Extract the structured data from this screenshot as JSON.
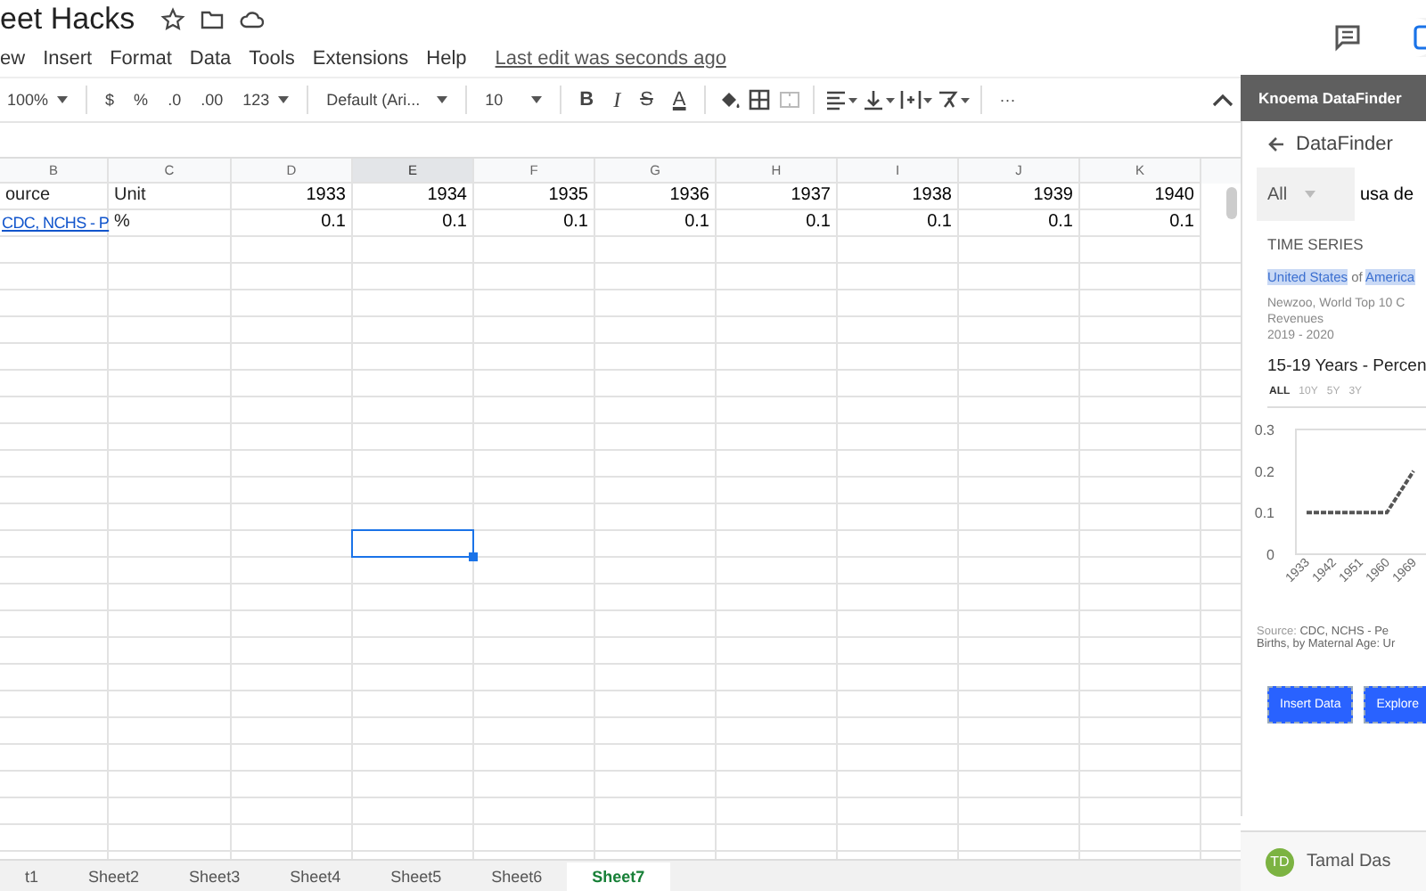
{
  "document": {
    "title": "eet Hacks"
  },
  "menu": [
    "ew",
    "Insert",
    "Format",
    "Data",
    "Tools",
    "Extensions",
    "Help"
  ],
  "last_edit": "Last edit was seconds ago",
  "toolbar": {
    "zoom": "100%",
    "currency": "$",
    "percent": "%",
    "decrease_decimals": ".0",
    "increase_decimals": ".00",
    "number_format": "123",
    "font": "Default (Ari...",
    "font_size": "10",
    "bold": "B",
    "italic": "I",
    "strikethrough": "S",
    "text_color": "A",
    "more": "···"
  },
  "columns": [
    {
      "label": "B",
      "selected": false
    },
    {
      "label": "C",
      "selected": false
    },
    {
      "label": "D",
      "selected": false
    },
    {
      "label": "E",
      "selected": true
    },
    {
      "label": "F",
      "selected": false
    },
    {
      "label": "G",
      "selected": false
    },
    {
      "label": "H",
      "selected": false
    },
    {
      "label": "I",
      "selected": false
    },
    {
      "label": "J",
      "selected": false
    },
    {
      "label": "K",
      "selected": false
    }
  ],
  "rows": [
    {
      "cells": [
        {
          "text": "ource",
          "kind": "text"
        },
        {
          "text": "Unit",
          "kind": "text"
        },
        {
          "text": "1933",
          "kind": "number"
        },
        {
          "text": "1934",
          "kind": "number"
        },
        {
          "text": "1935",
          "kind": "number"
        },
        {
          "text": "1936",
          "kind": "number"
        },
        {
          "text": "1937",
          "kind": "number"
        },
        {
          "text": "1938",
          "kind": "number"
        },
        {
          "text": "1939",
          "kind": "number"
        },
        {
          "text": "1940",
          "kind": "number"
        }
      ]
    },
    {
      "cells": [
        {
          "text": "CDC, NCHS - P",
          "kind": "link"
        },
        {
          "text": "%",
          "kind": "text"
        },
        {
          "text": "0.1",
          "kind": "number"
        },
        {
          "text": "0.1",
          "kind": "number"
        },
        {
          "text": "0.1",
          "kind": "number"
        },
        {
          "text": "0.1",
          "kind": "number"
        },
        {
          "text": "0.1",
          "kind": "number"
        },
        {
          "text": "0.1",
          "kind": "number"
        },
        {
          "text": "0.1",
          "kind": "number"
        },
        {
          "text": "0.1",
          "kind": "number"
        }
      ]
    }
  ],
  "sheet_tabs": [
    {
      "label": "t1",
      "selected": false
    },
    {
      "label": "Sheet2",
      "selected": false
    },
    {
      "label": "Sheet3",
      "selected": false
    },
    {
      "label": "Sheet4",
      "selected": false
    },
    {
      "label": "Sheet5",
      "selected": false
    },
    {
      "label": "Sheet6",
      "selected": false
    },
    {
      "label": "Sheet7",
      "selected": true
    }
  ],
  "panel": {
    "title": "Knoema DataFinder",
    "heading": "DataFinder",
    "filter": "All",
    "search_value": "usa de",
    "section": "TIME SERIES",
    "tags": [
      {
        "text": "United States",
        "highlighted": true
      },
      {
        "text": " of ",
        "highlighted": false
      },
      {
        "text": "America",
        "highlighted": true
      }
    ],
    "source_lines": [
      "Newzoo, World Top 10 C",
      "Revenues",
      "2019 - 2020"
    ],
    "series_title": "15-19 Years - Percen",
    "ranges": [
      {
        "label": "ALL",
        "selected": true
      },
      {
        "label": "10Y",
        "selected": false
      },
      {
        "label": "5Y",
        "selected": false
      },
      {
        "label": "3Y",
        "selected": false
      }
    ],
    "chart_data": {
      "type": "line",
      "categories": [
        "1933",
        "1942",
        "1951",
        "1960",
        "1969"
      ],
      "series": [
        {
          "color": "#555555",
          "line_style": "dashed",
          "values": [
            0.1,
            0.1,
            0.1,
            0.1,
            0.2
          ]
        }
      ],
      "ylim": [
        0,
        0.3
      ],
      "yticks": [
        0,
        0.1,
        0.2,
        0.3
      ]
    },
    "source_label": "Source:",
    "source_text": " CDC, NCHS - Pe",
    "source_text_2": "Births, by Maternal Age: Ur",
    "buttons": [
      "Insert Data",
      "Explore"
    ],
    "user": {
      "initials": "TD",
      "name": "Tamal Das"
    }
  }
}
